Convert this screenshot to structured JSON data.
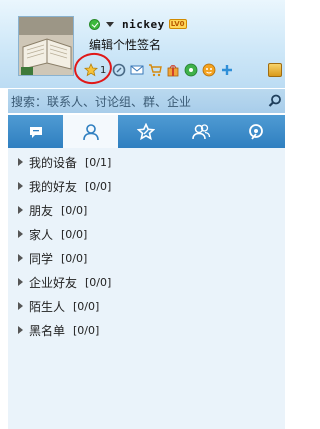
{
  "profile": {
    "nickname": "nickey",
    "level_badge": "LV0",
    "signature": "编辑个性签名",
    "star_count": "1"
  },
  "search": {
    "placeholder": "搜索：联系人、讨论组、群、企业"
  },
  "groups": [
    {
      "label": "我的设备",
      "count": "[0/1]"
    },
    {
      "label": "我的好友",
      "count": "[0/0]"
    },
    {
      "label": "朋友",
      "count": "[0/0]"
    },
    {
      "label": "家人",
      "count": "[0/0]"
    },
    {
      "label": "同学",
      "count": "[0/0]"
    },
    {
      "label": "企业好友",
      "count": "[0/0]"
    },
    {
      "label": "陌生人",
      "count": "[0/0]"
    },
    {
      "label": "黑名单",
      "count": "[0/0]"
    }
  ],
  "colors": {
    "accent": "#2f7fc0",
    "online": "#3cb93c",
    "annotation": "#e01818"
  },
  "icons": [
    "star-icon",
    "qzone-icon",
    "mail-icon",
    "shop-icon",
    "gift-icon",
    "music-icon",
    "game-icon",
    "add-icon",
    "toolbox-icon"
  ]
}
